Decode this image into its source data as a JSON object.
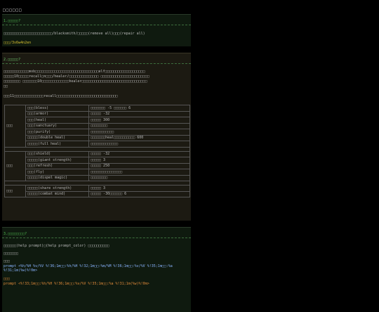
{
  "page_title": "□□□□□□",
  "section1": {
    "heading": "1.□□□□□?",
    "line1": "□□□□□□□□□□□□□□□□□□□□□□□/blacksmith/□□□□□(remove all)□□□(repair all)",
    "line2": "□□□/3s6w4n2en"
  },
  "section2": {
    "heading": "2.□□□□□?",
    "para1_a": "□□□□□□□□□□□□mob□□□□□□□□□□□□□□□□□□□□□□□□□□□□□□elf□□□□□□□□□□□□□□□□□□□",
    "para1_b": "□□□□□10□□□□□recall□n□□□/healer/□□□□□□□□□□□□□□ □□□□□□□□□□□□□□□□□□□□□□□",
    "para1_c": "□□□□□□□□ □□□□□□□10□□□□□□□□□□□□□healer□□□□□□□□□□□□□□□□□□□□□□□□□□□□□□□",
    "para1_d": "□□",
    "para2": "□□□11□□□□□□□□□□□□□□recall□□□□□□□□□□□□□□□□□□□□□□□□□□□□□",
    "groups": [
      {
        "label": "□□□",
        "rows": [
          {
            "name": "□□□(bless)",
            "effect": "□□□□□□□ -5 □□□□□□ 6"
          },
          {
            "name": "□□□(armor)",
            "effect": "□□□□□ -32"
          },
          {
            "name": "□□□(heal)",
            "effect": "□□□□□ 300"
          },
          {
            "name": "□□□(sanctuary)",
            "effect": "□□□□□□□□"
          },
          {
            "name": "□□□(purify)",
            "effect": "□□□□□□□□□□□"
          },
          {
            "name": "□□□□□(double heal)",
            "effect": "□□□□□□□heal□□□□□□□□□□ 600"
          },
          {
            "name": "□□□□□(full heal)",
            "effect": "□□□□□□□□□□□□□"
          }
        ]
      },
      {
        "label": "□□□",
        "rows": [
          {
            "name": "□□□(shield)",
            "effect": "□□□□□ -32"
          },
          {
            "name": "□□□□□(giant strength)",
            "effect": "□□□□□ 3"
          },
          {
            "name": "□□□(refresh)",
            "effect": "□□□□□ 250"
          },
          {
            "name": "□□□(fly)",
            "effect": "□□□□□□□□□□□□□□□"
          },
          {
            "name": "□□□□□(dispel magic)",
            "effect": "□□□□□□□□"
          }
        ]
      },
      {
        "label": "□□□",
        "rows": [
          {
            "name": "□□□□□(share strength)",
            "effect": "□□□□□ 3"
          },
          {
            "name": "□□□□□(combat mind)",
            "effect": "□□□□□ -30□□□□□□ 6"
          }
        ]
      }
    ]
  },
  "section3": {
    "heading": "3.□□□□□□□□?",
    "line1": "□□□□□□(help prompt)□(help prompt_color) □□□□□□□□□□",
    "line2": "□□□□□□□",
    "label1": "□□□",
    "prompt1_a": "prompt <%h/%H %v/%V %!36;1m□□:%h/%H %!32;1m□□:%m/%M %!36;1m□□:%v/%V %!35;1m□□:%a",
    "prompt1_b": "%!31;1m(%w)%!0m>",
    "label2": "□□□",
    "prompt2": "prompt <%!33;1m□□:%h/%H %!36;1m□□:%v/%V %!35;1m□□:%a %!31;1m(%w)%!0m>"
  }
}
